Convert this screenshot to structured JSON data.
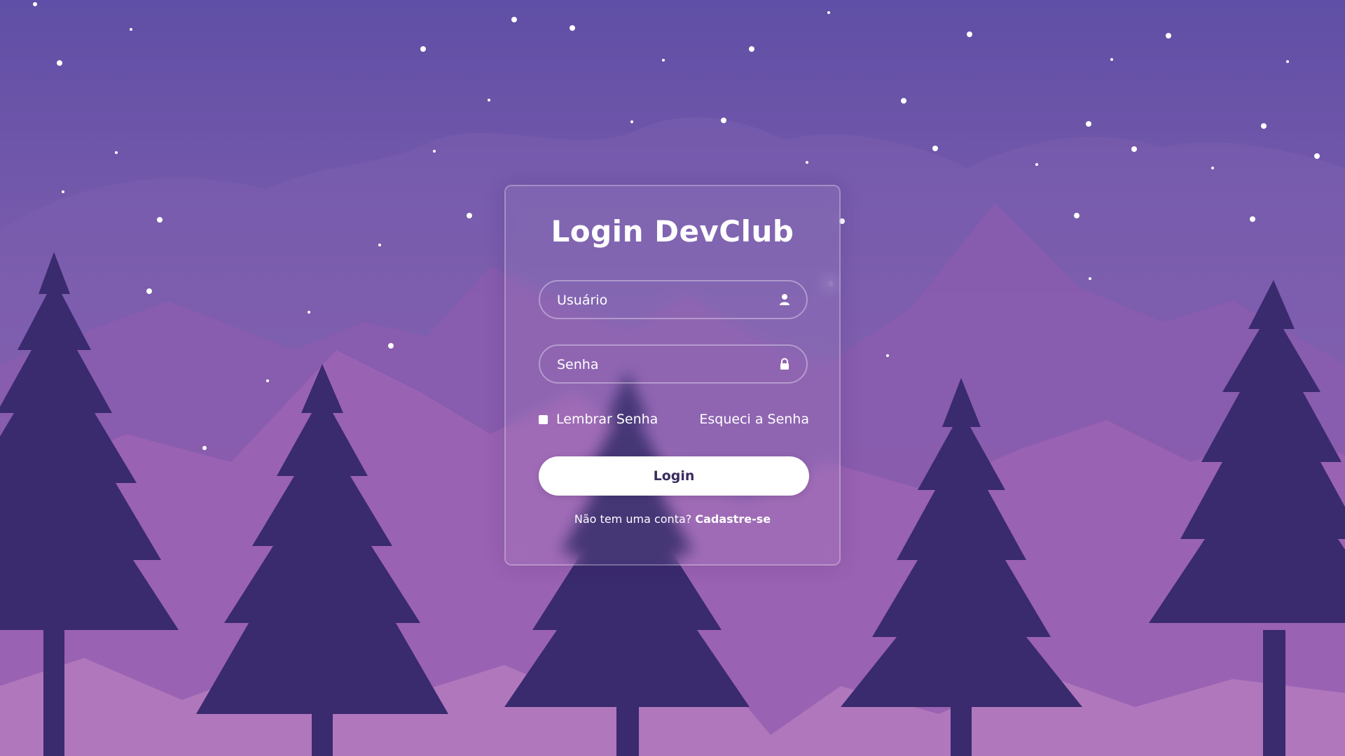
{
  "form": {
    "title": "Login DevClub",
    "username_placeholder": "Usuário",
    "password_placeholder": "Senha",
    "remember_label": "Lembrar Senha",
    "forgot_label": "Esqueci a Senha",
    "login_button": "Login",
    "register_prompt": "Não tem uma conta?",
    "register_link": "Cadastre-se"
  },
  "icons": {
    "username": "user-icon",
    "password": "lock-icon"
  },
  "colors": {
    "sky_top": "#5f4fa6",
    "sky_bottom": "#b174b8",
    "trees": "#3a2a6e",
    "button_bg": "#ffffff",
    "button_text": "#3b2d5e"
  }
}
